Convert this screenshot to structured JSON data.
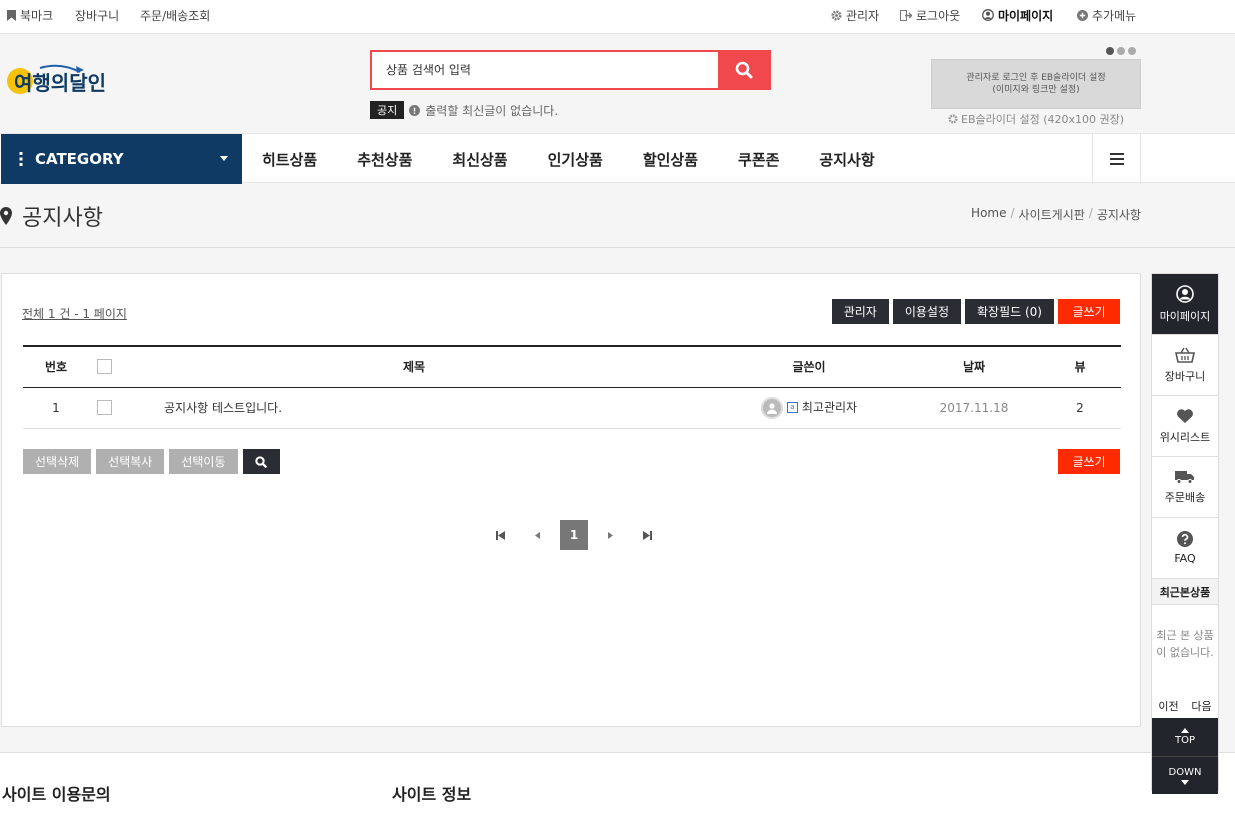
{
  "topbar": {
    "bookmark": "북마크",
    "cart": "장바구니",
    "order": "주문/배송조회",
    "admin": "관리자",
    "logout": "로그아웃",
    "mypage": "마이페이지",
    "more": "추가메뉴"
  },
  "header": {
    "logo_text": "여행의달인",
    "search_placeholder": "상품 검색어 입력",
    "notice_tag": "공지",
    "notice_text": "출력할 최신글이 없습니다.",
    "banner_line1": "관리자로 로그인 후 EB슬라이더 설정",
    "banner_line2": "(이미지와 링크만 설정)",
    "banner_caption": "EB슬라이더 설정 (420x100 권장)"
  },
  "nav": {
    "category": "CATEGORY",
    "items": [
      "히트상품",
      "추천상품",
      "최신상품",
      "인기상품",
      "할인상품",
      "쿠폰존",
      "공지사항"
    ]
  },
  "page": {
    "title": "공지사항",
    "breadcrumb": [
      "Home",
      "사이트게시판",
      "공지사항"
    ]
  },
  "board": {
    "total": "전체 1 건 - 1 페이지",
    "buttons": {
      "admin": "관리자",
      "settings": "이용설정",
      "ext": "확장필드 (0)",
      "write": "글쓰기"
    },
    "columns": {
      "no": "번호",
      "title": "제목",
      "author": "글쓴이",
      "date": "날짜",
      "views": "뷰"
    },
    "rows": [
      {
        "no": "1",
        "title": "공지사항 테스트입니다.",
        "author": "최고관리자",
        "level": "a",
        "date": "2017.11.18",
        "views": "2"
      }
    ],
    "actions": {
      "delete": "선택삭제",
      "copy": "선택복사",
      "move": "선택이동"
    },
    "write2": "글쓰기",
    "current_page": "1"
  },
  "side": {
    "mypage": "마이페이지",
    "cart": "장바구니",
    "wish": "위시리스트",
    "delivery": "주문배송",
    "faq": "FAQ",
    "recent_title": "최근본상품",
    "recent_empty_1": "최근 본 상품",
    "recent_empty_2": "이 없습니다.",
    "prev": "이전",
    "next": "다음",
    "top": "TOP",
    "down": "DOWN"
  },
  "footer": {
    "inquiry": "사이트 이용문의",
    "info": "사이트 정보"
  },
  "colors": {
    "brand_navy": "#0e3a63",
    "search_red": "#f0484d",
    "write_red": "#ff2a00",
    "dark_button": "#2b2d35"
  }
}
